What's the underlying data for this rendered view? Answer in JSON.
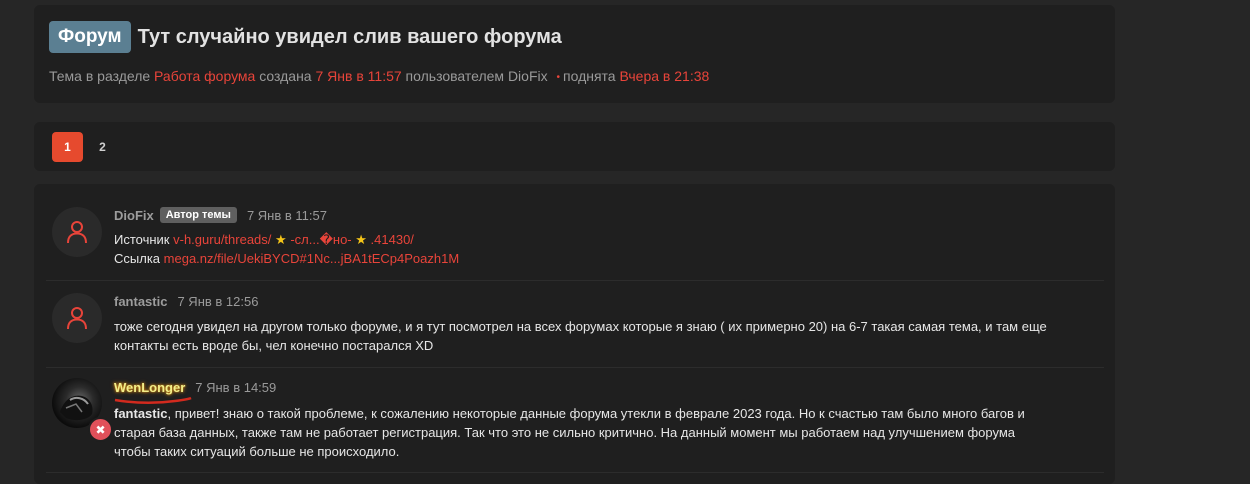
{
  "thread": {
    "prefix": "Форум",
    "title": "Тут случайно увидел слив вашего форума",
    "meta": {
      "t1": "Тема в разделе",
      "section": "Работа форума",
      "t2": "созданa",
      "created": "7 Янв в 11:57",
      "t3": "пользователем",
      "author": "DioFix",
      "dot": "•",
      "t4": "поднята",
      "bumped": "Вчера в 21:38"
    }
  },
  "pagination": {
    "pages": [
      "1",
      "2"
    ],
    "current": "1"
  },
  "posts": [
    {
      "username": "DioFix",
      "badge": "Автор темы",
      "date": "7 Янв в 11:57",
      "avatar_icon": "user-icon",
      "lines": {
        "l1_label": "Источник",
        "l1_link_a": "v-h.guru/threads/",
        "star": "★",
        "l1_link_b": "-сл...�но-",
        "l1_link_c": ".41430/",
        "l2_label": "Ссылка",
        "l2_link": "mega.nz/file/UekiBYCD#1Nc...jBA1tECp4Poazh1M"
      }
    },
    {
      "username": "fantastic",
      "date": "7 Янв в 12:56",
      "avatar_icon": "user-icon",
      "text_l1": "тоже сегодня увидел на другом только форуме, и я тут посмотрел на всех форумах которые я знаю ( их примерно 20) на 6-7 такая самая тема, и там еще",
      "text_l2": "контакты есть вроде бы, чел конечно постарался XD"
    },
    {
      "username": "WenLonger",
      "date": "7 Янв в 14:59",
      "avatar_icon": "avatar-photo",
      "status_icon": "banned-icon",
      "mention": "fantastic",
      "text_l1": ", привет! знаю о такой проблеме, к сожалению некоторые данные форума утекли в феврале 2023 года. Но к счастью там было много багов и",
      "text_l2": "старая база данных, также там не работает регистрация. Так что это не сильно критично. На данный момент мы работаем над улучшением форума",
      "text_l3": "чтобы таких ситуаций больше не происходило."
    }
  ],
  "colors": {
    "background": "#262626",
    "panel": "#1f1f1f",
    "accent_link": "#e8443a",
    "prefix_badge": "#5b7f92",
    "active_page": "#e64a2e"
  }
}
